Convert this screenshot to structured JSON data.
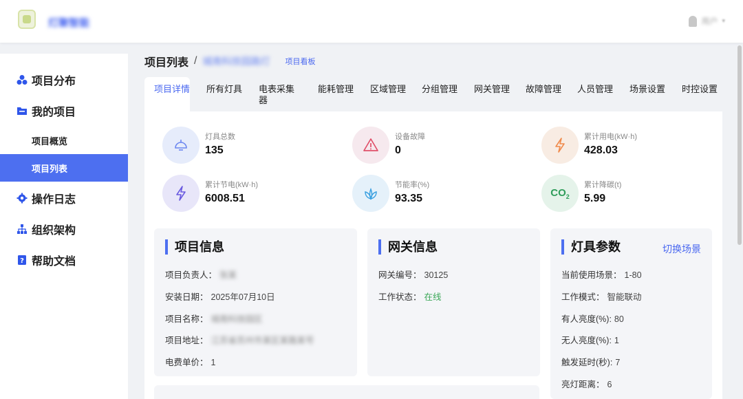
{
  "header": {
    "brand": "灯聚智能",
    "user_name": "用户",
    "caret": "▾"
  },
  "sidebar": {
    "items": [
      {
        "label": "项目分布",
        "icon": "cluster-icon"
      },
      {
        "label": "我的项目",
        "icon": "folder-icon"
      },
      {
        "label": "项目概览",
        "icon": ""
      },
      {
        "label": "项目列表",
        "icon": "",
        "active": true
      },
      {
        "label": "操作日志",
        "icon": "gear-icon"
      },
      {
        "label": "组织架构",
        "icon": "org-chart-icon"
      },
      {
        "label": "帮助文档",
        "icon": "help-doc-icon"
      }
    ]
  },
  "breadcrumb": {
    "title": "项目列表",
    "separator": "/",
    "project": "城南科技园路灯",
    "board_link": "项目看板"
  },
  "tabs": [
    {
      "label": "项目详情",
      "active": true
    },
    {
      "label": "所有灯具"
    },
    {
      "label": "电表采集器"
    },
    {
      "label": "能耗管理"
    },
    {
      "label": "区域管理"
    },
    {
      "label": "分组管理"
    },
    {
      "label": "网关管理"
    },
    {
      "label": "故障管理"
    },
    {
      "label": "人员管理"
    },
    {
      "label": "场景设置"
    },
    {
      "label": "时控设置"
    }
  ],
  "stats": [
    {
      "label": "灯具总数",
      "value": "135",
      "icon": "lamp-icon",
      "color": "#4a68f0"
    },
    {
      "label": "设备故障",
      "value": "0",
      "icon": "warning-icon",
      "color": "#e0506a"
    },
    {
      "label": "累计用电(kW·h)",
      "value": "428.03",
      "icon": "bolt-icon",
      "color": "#f08a4b"
    },
    {
      "label": "累计节电(kW·h)",
      "value": "6008.51",
      "icon": "bolt-outline-icon",
      "color": "#6a5ae0"
    },
    {
      "label": "节能率(%)",
      "value": "93.35",
      "icon": "leaf-icon",
      "color": "#3aa0e0"
    },
    {
      "label": "累计降碳(t)",
      "value": "5.99",
      "icon": "co2-icon",
      "color": "#2f9d5a"
    }
  ],
  "co2_text": "CO",
  "co2_sub": "2",
  "project_info": {
    "title": "项目信息",
    "rows": [
      {
        "label": "项目负责人：",
        "value": "张某",
        "blurred": true
      },
      {
        "label": "安装日期：",
        "value": "2025年07月10日"
      },
      {
        "label": "项目名称：",
        "value": "城南科技园区",
        "blurred": true
      },
      {
        "label": "项目地址：",
        "value": "江苏省苏州市某区某路某号",
        "blurred": true
      },
      {
        "label": "电费单价：",
        "value": "1"
      }
    ]
  },
  "gateway_info": {
    "title": "网关信息",
    "rows": [
      {
        "label": "网关编号：",
        "value": "30125"
      },
      {
        "label": "工作状态：",
        "value": "在线",
        "status": "online"
      }
    ]
  },
  "lamp_params": {
    "title": "灯具参数",
    "action": "切换场景",
    "rows": [
      {
        "label": "当前使用场景：",
        "value": "1-80"
      },
      {
        "label": "工作模式：",
        "value": "智能联动"
      },
      {
        "label": "有人亮度(%):",
        "value": "80"
      },
      {
        "label": "无人亮度(%):",
        "value": "1"
      },
      {
        "label": "触发延时(秒):",
        "value": "7"
      },
      {
        "label": "亮灯距离：",
        "value": "6"
      }
    ]
  }
}
